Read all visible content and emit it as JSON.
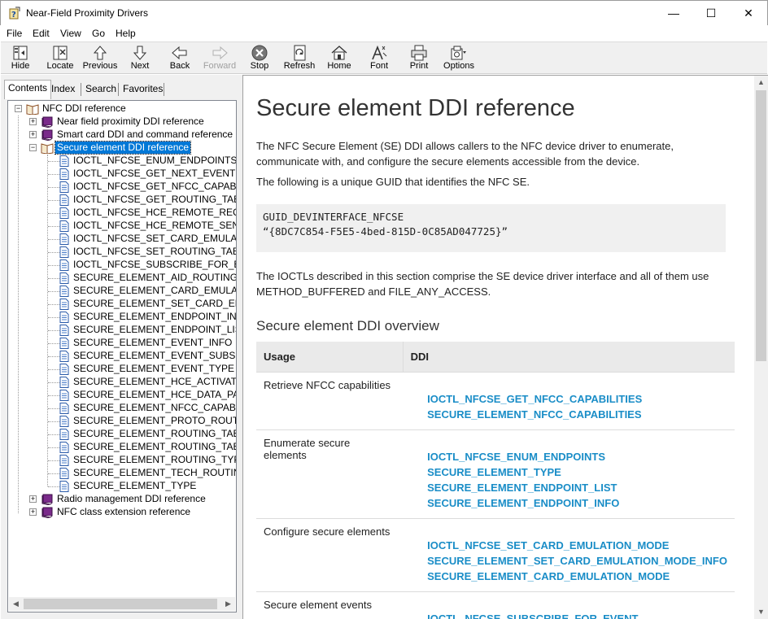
{
  "window": {
    "title": "Near-Field Proximity Drivers",
    "minimize": "—",
    "maximize": "☐",
    "close": "✕"
  },
  "menu": [
    "File",
    "Edit",
    "View",
    "Go",
    "Help"
  ],
  "toolbar": [
    {
      "label": "Hide",
      "icon": "hide-icon",
      "enabled": true
    },
    {
      "label": "Locate",
      "icon": "locate-icon",
      "enabled": true
    },
    {
      "label": "Previous",
      "icon": "up-arrow-icon",
      "enabled": true
    },
    {
      "label": "Next",
      "icon": "down-arrow-icon",
      "enabled": true
    },
    {
      "label": "Back",
      "icon": "back-arrow-icon",
      "enabled": true
    },
    {
      "label": "Forward",
      "icon": "forward-arrow-icon",
      "enabled": false
    },
    {
      "label": "Stop",
      "icon": "stop-icon",
      "enabled": true
    },
    {
      "label": "Refresh",
      "icon": "refresh-icon",
      "enabled": true
    },
    {
      "label": "Home",
      "icon": "home-icon",
      "enabled": true
    },
    {
      "label": "Font",
      "icon": "font-icon",
      "enabled": true
    },
    {
      "label": "Print",
      "icon": "print-icon",
      "enabled": true
    },
    {
      "label": "Options",
      "icon": "options-icon",
      "enabled": true
    }
  ],
  "nav_tabs": [
    "Contents",
    "Index",
    "Search",
    "Favorites"
  ],
  "active_tab": "Contents",
  "tree": {
    "root": "NFC DDI reference",
    "books": [
      {
        "label": "Near field proximity DDI reference",
        "expanded": false
      },
      {
        "label": "Smart card DDI and command reference",
        "expanded": false
      },
      {
        "label": "Secure element DDI reference",
        "expanded": true,
        "selected": true
      },
      {
        "label": "Radio management DDI reference",
        "expanded": false
      },
      {
        "label": "NFC class extension reference",
        "expanded": false
      }
    ],
    "pages": [
      "IOCTL_NFCSE_ENUM_ENDPOINTS",
      "IOCTL_NFCSE_GET_NEXT_EVENT",
      "IOCTL_NFCSE_GET_NFCC_CAPABILITIES",
      "IOCTL_NFCSE_GET_ROUTING_TABLE",
      "IOCTL_NFCSE_HCE_REMOTE_RECV",
      "IOCTL_NFCSE_HCE_REMOTE_SEND",
      "IOCTL_NFCSE_SET_CARD_EMULATION_MODE",
      "IOCTL_NFCSE_SET_ROUTING_TABLE",
      "IOCTL_NFCSE_SUBSCRIBE_FOR_EVENT",
      "SECURE_ELEMENT_AID_ROUTING_INFO",
      "SECURE_ELEMENT_CARD_EMULATION_MODE",
      "SECURE_ELEMENT_SET_CARD_EMULATION_MODE_INFO",
      "SECURE_ELEMENT_ENDPOINT_INFO",
      "SECURE_ELEMENT_ENDPOINT_LIST",
      "SECURE_ELEMENT_EVENT_INFO",
      "SECURE_ELEMENT_EVENT_SUBSCRIPTION_INFO",
      "SECURE_ELEMENT_EVENT_TYPE",
      "SECURE_ELEMENT_HCE_ACTIVATION_PAYLOAD",
      "SECURE_ELEMENT_HCE_DATA_PACKET",
      "SECURE_ELEMENT_NFCC_CAPABILITIES",
      "SECURE_ELEMENT_PROTO_ROUTING_INFO",
      "SECURE_ELEMENT_ROUTING_TABLE",
      "SECURE_ELEMENT_ROUTING_TABLE_ENTRY",
      "SECURE_ELEMENT_ROUTING_TYPE",
      "SECURE_ELEMENT_TECH_ROUTING_INFO",
      "SECURE_ELEMENT_TYPE"
    ]
  },
  "content": {
    "title": "Secure element DDI reference",
    "intro": "The NFC Secure Element (SE) DDI allows callers to the NFC device driver to enumerate, communicate with, and configure the secure elements accessible from the device.",
    "guid_intro": "The following is a unique GUID that identifies the NFC SE.",
    "code_line1": "GUID_DEVINTERFACE_NFCSE",
    "code_line2": "“{8DC7C854-F5E5-4bed-815D-0C85AD047725}”",
    "ioctl_note": "The IOCTLs described in this section comprise the SE device driver interface and all of them use METHOD_BUFFERED and FILE_ANY_ACCESS.",
    "overview_heading": "Secure element DDI overview",
    "table_headers": [
      "Usage",
      "DDI"
    ],
    "rows": [
      {
        "usage": "Retrieve NFCC capabilities",
        "ddis": [
          "IOCTL_NFCSE_GET_NFCC_CAPABILITIES",
          "SECURE_ELEMENT_NFCC_CAPABILITIES"
        ]
      },
      {
        "usage": "Enumerate secure elements",
        "ddis": [
          "IOCTL_NFCSE_ENUM_ENDPOINTS",
          "SECURE_ELEMENT_TYPE",
          "SECURE_ELEMENT_ENDPOINT_LIST",
          "SECURE_ELEMENT_ENDPOINT_INFO"
        ]
      },
      {
        "usage": "Configure secure elements",
        "ddis": [
          "IOCTL_NFCSE_SET_CARD_EMULATION_MODE",
          "SECURE_ELEMENT_SET_CARD_EMULATION_MODE_INFO",
          "SECURE_ELEMENT_CARD_EMULATION_MODE"
        ]
      },
      {
        "usage": "Secure element events",
        "ddis": [
          "IOCTL_NFCSE_SUBSCRIBE_FOR_EVENT"
        ]
      }
    ]
  },
  "colors": {
    "link": "#1a8dc7",
    "selection": "#0078d7",
    "book": "#7a2a8a"
  }
}
